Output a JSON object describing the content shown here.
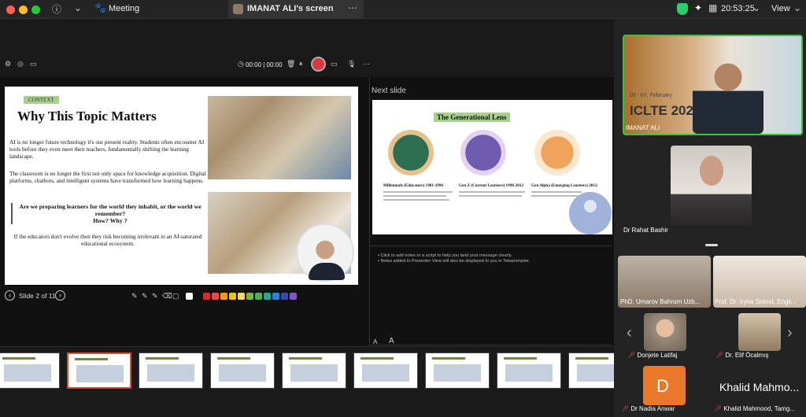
{
  "window": {
    "meeting_label": "Meeting",
    "screen_tab": "IMANAT ALI's screen",
    "clock": "20:53:25",
    "view_label": "View",
    "timer": "00:00 | 00:00",
    "next_slide_label": "Next slide",
    "slide_counter": "Slide 2 of 11",
    "font_decrease": "A",
    "font_increase": "A",
    "notes": [
      "• Click to add notes or a script to help you land your message clearly.",
      "• Notes added to Presenter View will also be displayed to you in Teleprompter."
    ]
  },
  "slide": {
    "tag": "CONTEXT",
    "title": "Why This Topic Matters",
    "p1": "AI is no longer future technology it's our present reality. Students often encounter AI tools before they even meet their teachers, fundamentally shifting the learning landscape.",
    "p2": "The classroom is no longer the first nor only space for knowledge acquisition. Digital platforms, chatbots, and intelligent systems have transformed how learning happens.",
    "quote_line1": "Are we preparing learners for the world they inhabit, or the world we remember?",
    "quote_line2": "How? Why ?",
    "p3": "If the educators don't evolve then they risk becoming irrelevant in an AI-saturated educational ecosystem."
  },
  "next": {
    "title": "The Generational Lens",
    "col1": "Millennials (Educators) 1981-1996",
    "col2": "Gen Z (Current Learners) 1996-2012",
    "col3": "Gen Alpha (Emerging Learners) 2012-"
  },
  "palette": [
    "#ffffff",
    "#111111",
    "#d32f2f",
    "#e74c3c",
    "#f39c12",
    "#f1c40f",
    "#f5d76e",
    "#7cb342",
    "#4caf50",
    "#26a69a",
    "#1e88e5",
    "#3949ab",
    "#7e57c2"
  ],
  "participants": {
    "speaker_name": "IMANAT ALI",
    "speaker_banner_date": "05 - 07, February",
    "speaker_banner_title": "ICLTE 2026",
    "p1": "Dr Rahat Bashir",
    "p2": "PhD. Umarov Bahrom Uzb...",
    "p3": "Prof. Dr. Iryna Sekret, Engli...",
    "p4": "Donjete Latifaj",
    "p5": "Dr. Elif Öcalmış",
    "p6": "Dr Nadia Anwar",
    "p7": "Khalid Mahmood, Tamg...",
    "p7_big": "Khalid Mahmo...",
    "p6_initial": "D"
  }
}
